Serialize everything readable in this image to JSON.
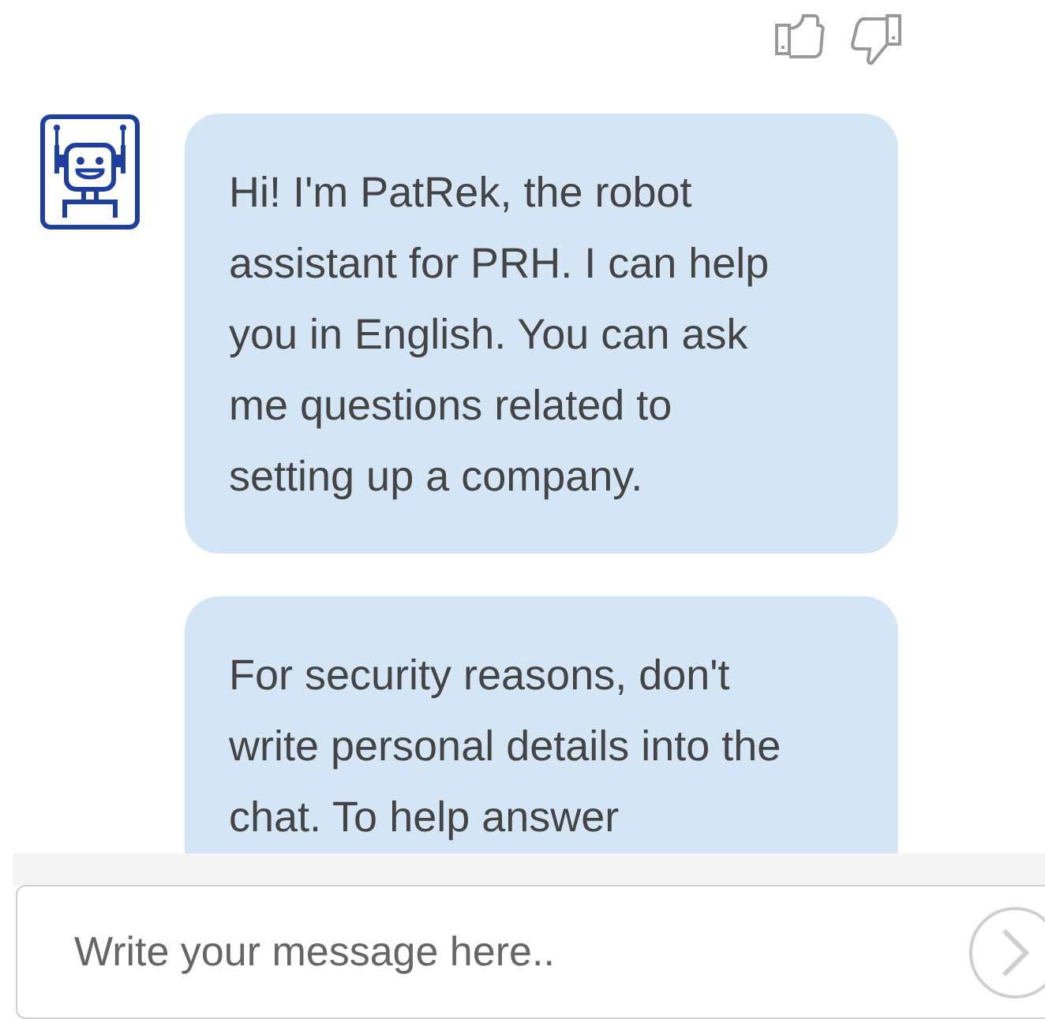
{
  "feedback": {
    "thumbs_up": true,
    "thumbs_down": true
  },
  "messages": [
    {
      "text": "Hi! I'm PatRek, the robot assistant for PRH. I can help you in English. You can ask me questions related to setting up a company.",
      "avatar": true
    },
    {
      "text": "For security reasons, don't write personal details into the chat. To help answer",
      "avatar": false
    }
  ],
  "composer": {
    "placeholder": "Write your message here.."
  }
}
